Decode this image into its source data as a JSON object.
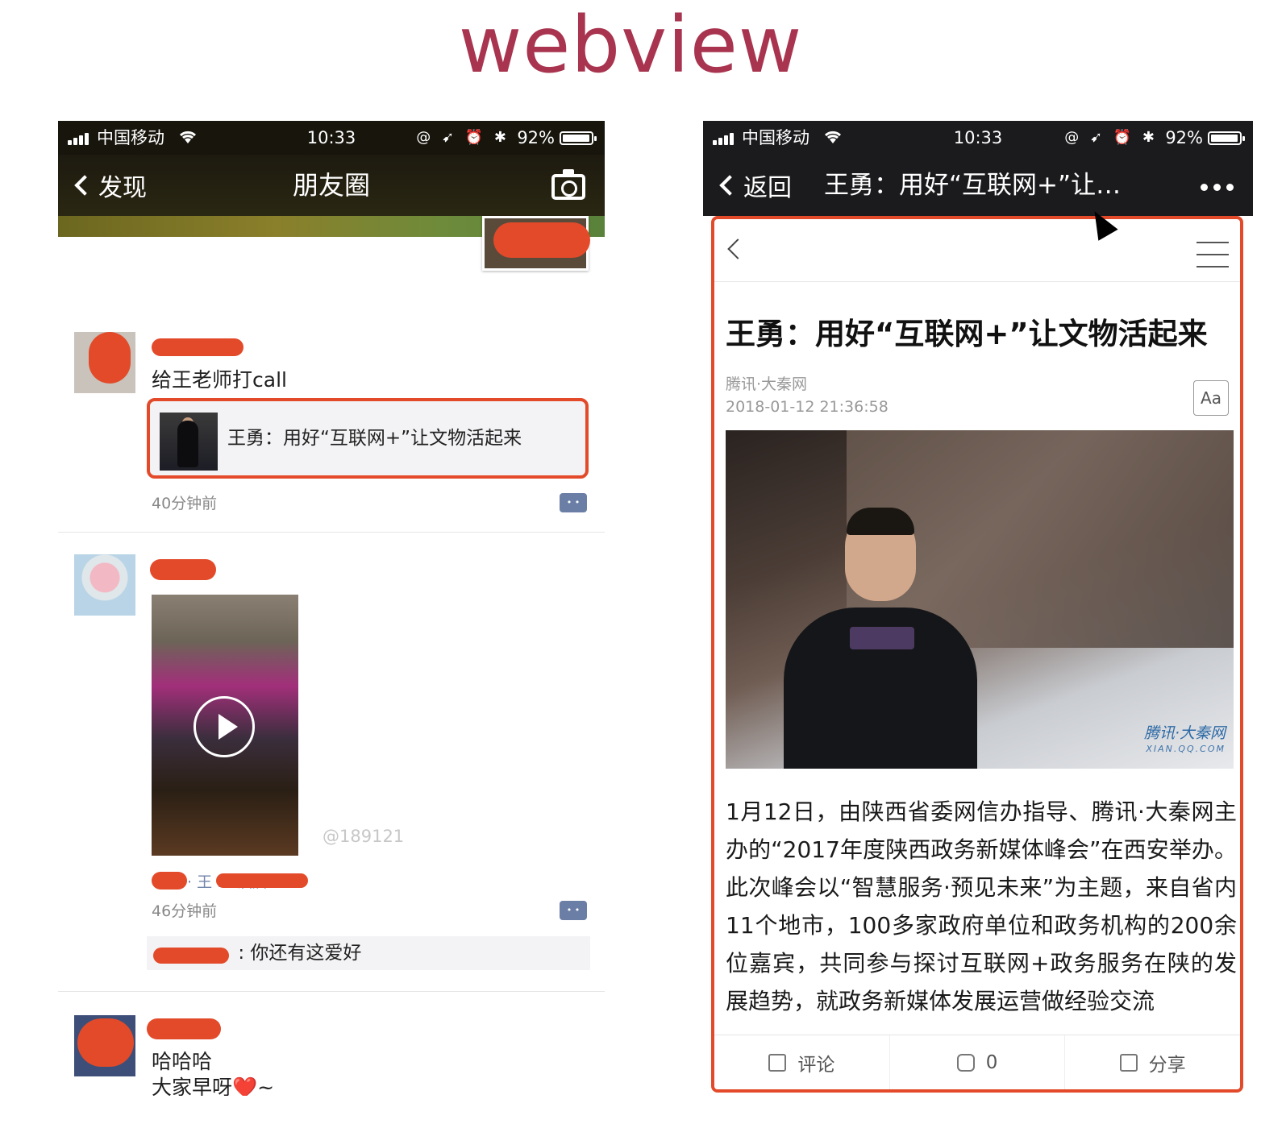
{
  "slide": {
    "title": "webview"
  },
  "left_phone": {
    "status": {
      "carrier": "中国移动",
      "time": "10:33",
      "icons": "@ ➹ ⏰ ✱",
      "battery": "92%"
    },
    "nav": {
      "back": "发现",
      "title": "朋友圈",
      "camera_icon": "camera-icon"
    },
    "posts": [
      {
        "text": "给王老师打call",
        "link_title": "王勇：用好“互联网+”让文物活起来",
        "time": "40分钟前"
      },
      {
        "location": "· 王 … 酒店",
        "time": "46分钟前",
        "comment": ": 你还有这爱好"
      },
      {
        "text_line1": "哈哈哈",
        "text_line2": "大家早呀",
        "emoji": "❤️",
        "tilde": "~"
      }
    ],
    "watermark": "@189121"
  },
  "right_phone": {
    "status": {
      "carrier": "中国移动",
      "time": "10:33",
      "icons": "@ ➹ ⏰ ✱",
      "battery": "92%"
    },
    "nav": {
      "back": "返回",
      "title": "王勇：用好“互联网+”让…"
    },
    "article": {
      "title": "王勇：用好“互联网+”让文物活起来",
      "source": "腾讯·大秦网",
      "date": "2018-01-12 21:36:58",
      "font_button": "Aa",
      "photo_logo": "腾讯·大秦网",
      "photo_logo_sub": "XIAN.QQ.COM",
      "body": "1月12日，由陕西省委网信办指导、腾讯·大秦网主办的“2017年度陕西政务新媒体峰会”在西安举办。此次峰会以“智慧服务·预见未来”为主题，来自省内11个地市，100多家政府单位和政务机构的200余位嘉宾，共同参与探讨互联网+政务服务在陕的发展趋势，就政务新媒体发展运营做经验交流"
    },
    "bottom_bar": {
      "comment": "评论",
      "count": "0",
      "share": "分享"
    }
  },
  "colors": {
    "title": "#a8344f",
    "highlight": "#e24a2a",
    "link_blue": "#7285ab"
  }
}
